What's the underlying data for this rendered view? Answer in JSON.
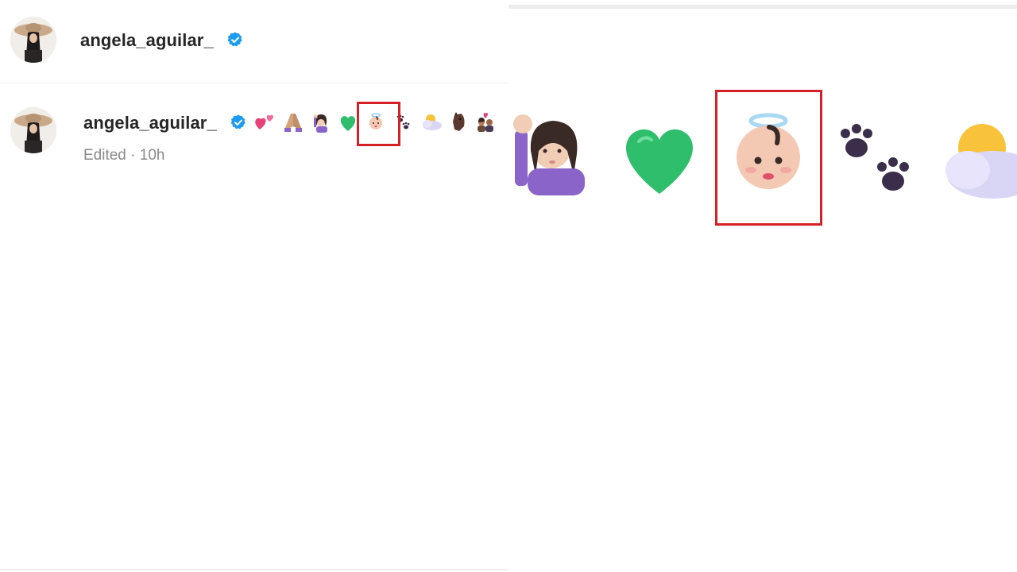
{
  "header_post": {
    "username": "angela_aguilar_",
    "verified": true
  },
  "comment": {
    "username": "angela_aguilar_",
    "verified": true,
    "emojis": [
      "two-hearts",
      "folded-hands",
      "woman-tipping-hand",
      "green-heart",
      "baby-angel",
      "paw-prints",
      "sun-behind-cloud",
      "horse-face",
      "couple-with-heart"
    ],
    "edited_label": "Edited",
    "separator": "·",
    "time": "10h",
    "highlighted_emoji": "baby-angel"
  },
  "zoom_panel": {
    "emojis": [
      "woman-tipping-hand",
      "green-heart",
      "baby-angel",
      "paw-prints",
      "sun-behind-cloud"
    ],
    "highlighted_emoji": "baby-angel"
  },
  "colors": {
    "highlight": "#d62027",
    "verified": "#1d9bf0",
    "meta_text": "#8a8a8a",
    "username_text": "#262626"
  }
}
